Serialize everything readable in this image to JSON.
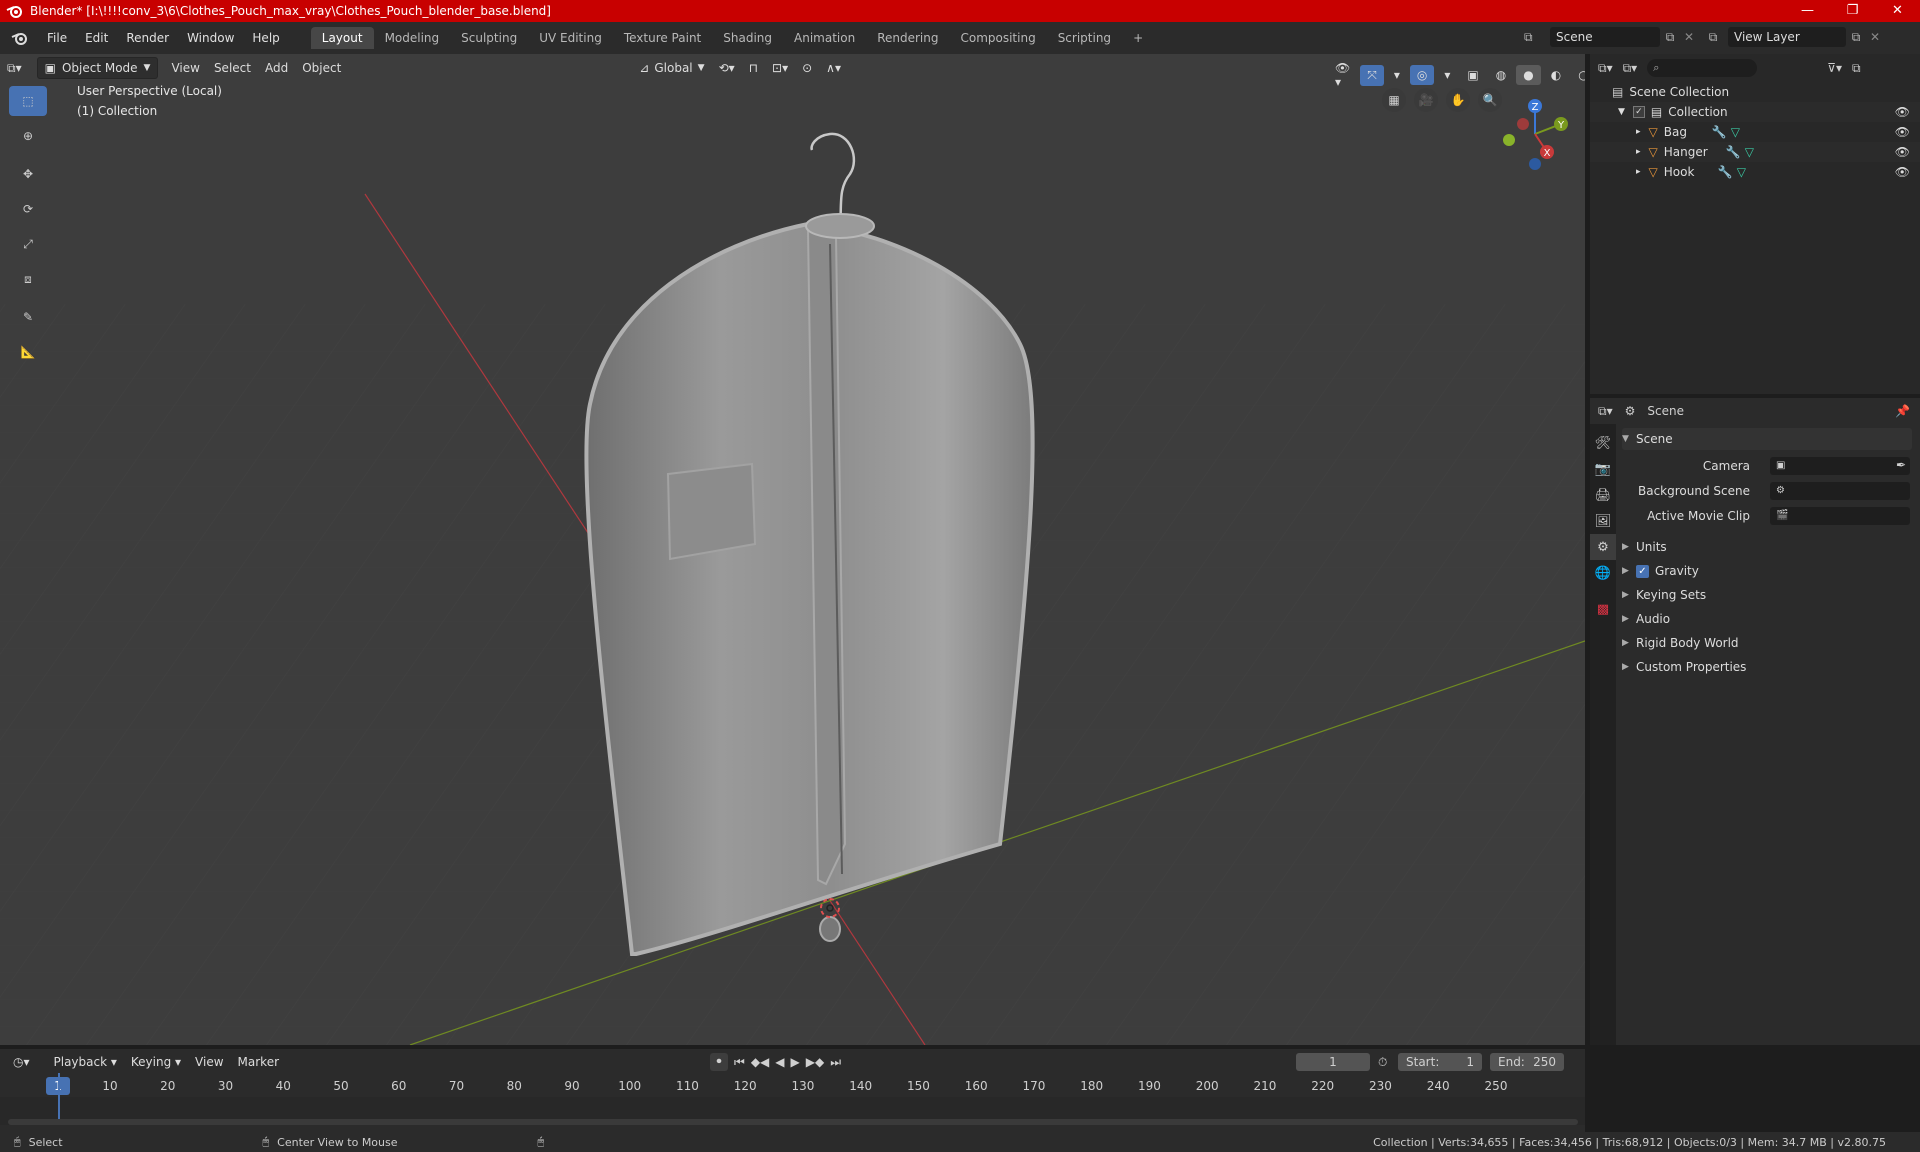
{
  "window": {
    "title": "Blender* [I:\\!!!!conv_3\\6\\Clothes_Pouch_max_vray\\Clothes_Pouch_blender_base.blend]",
    "controls": [
      "—",
      "❐",
      "✕"
    ]
  },
  "menu": {
    "items": [
      "File",
      "Edit",
      "Render",
      "Window",
      "Help"
    ],
    "workspaces": [
      "Layout",
      "Modeling",
      "Sculpting",
      "UV Editing",
      "Texture Paint",
      "Shading",
      "Animation",
      "Rendering",
      "Compositing",
      "Scripting"
    ],
    "active_workspace": "Layout",
    "add_tab": "+",
    "scene": "Scene",
    "view_layer": "View Layer"
  },
  "viewport_header": {
    "mode": "Object Mode",
    "menus": [
      "View",
      "Select",
      "Add",
      "Object"
    ],
    "transform_orientation": "Global"
  },
  "viewport": {
    "perspective": "User Perspective (Local)",
    "collection": "(1) Collection",
    "gizmo_axes": {
      "x": "X",
      "y": "Y",
      "z": "Z"
    }
  },
  "outliner": {
    "root": "Scene Collection",
    "collection": "Collection",
    "objects": [
      "Bag",
      "Hanger",
      "Hook"
    ],
    "search_placeholder": ""
  },
  "properties": {
    "context": "Scene",
    "panel": "Scene",
    "fields": [
      {
        "label": "Camera",
        "value": ""
      },
      {
        "label": "Background Scene",
        "value": ""
      },
      {
        "label": "Active Movie Clip",
        "value": ""
      }
    ],
    "subpanels": [
      "Units",
      "Gravity",
      "Keying Sets",
      "Audio",
      "Rigid Body World",
      "Custom Properties"
    ],
    "gravity_checked": true
  },
  "timeline": {
    "menus": [
      "Playback",
      "Keying",
      "View",
      "Marker"
    ],
    "current_frame": "1",
    "start_label": "Start:",
    "start": "1",
    "end_label": "End:",
    "end": "250",
    "ticks": [
      "1",
      "10",
      "20",
      "30",
      "40",
      "50",
      "60",
      "70",
      "80",
      "90",
      "100",
      "110",
      "120",
      "130",
      "140",
      "150",
      "160",
      "170",
      "180",
      "190",
      "200",
      "210",
      "220",
      "230",
      "240",
      "250"
    ]
  },
  "statusbar": {
    "select": "Select",
    "center": "Center View to Mouse",
    "stats": "Collection | Verts:34,655 | Faces:34,456 | Tris:68,912 | Objects:0/3 | Mem: 34.7 MB | v2.80.75"
  },
  "colors": {
    "titlebar": "#c80000",
    "accent": "#4772b3",
    "x_axis": "#c83a3a",
    "y_axis": "#7a9a1e",
    "z_axis": "#3b78d8"
  }
}
